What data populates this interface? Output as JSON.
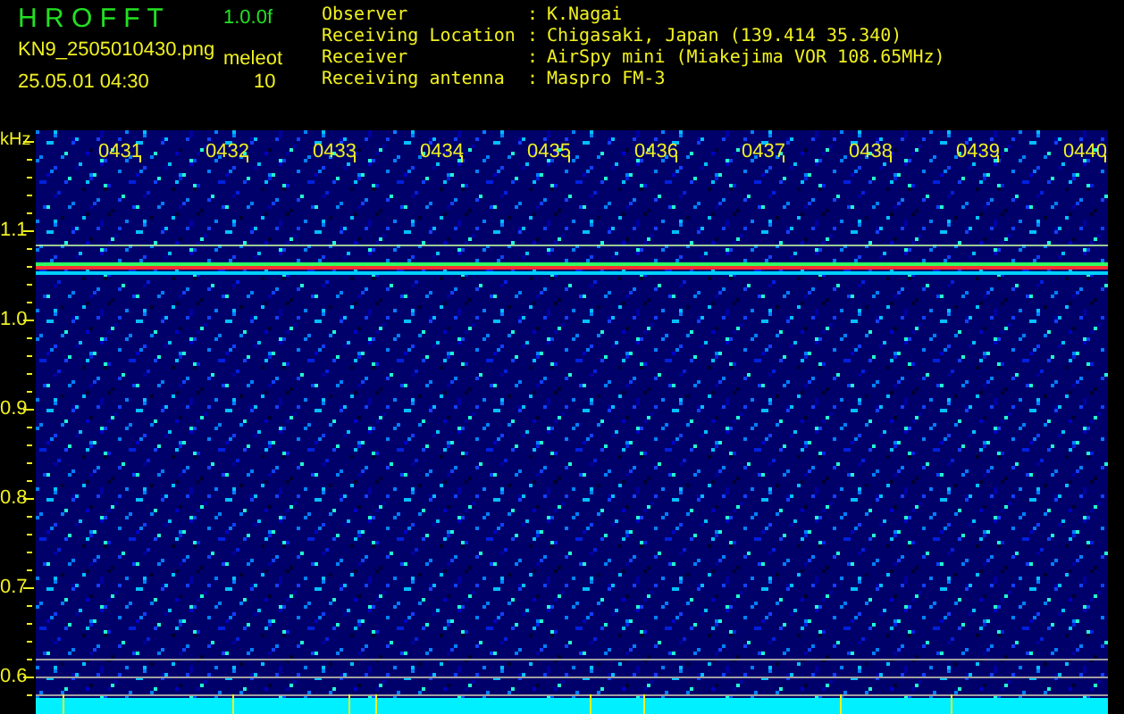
{
  "header": {
    "app_title": "H R O F F T",
    "version": "1.0.0f",
    "filename": "KN9_2505010430.png",
    "datetime": "25.05.01 04:30",
    "meteor_label": "meleot",
    "meteor_count": "10"
  },
  "info": [
    {
      "label": "Observer",
      "separator": ":",
      "value": "K.Nagai"
    },
    {
      "label": "Receiving Location",
      "separator": ":",
      "value": "Chigasaki, Japan (139.414 35.340)"
    },
    {
      "label": "Receiver",
      "separator": ":",
      "value": "AirSpy mini (Miakejima VOR 108.65MHz)"
    },
    {
      "label": "Receiving antenna",
      "separator": ":",
      "value": "Maspro FM-3"
    }
  ],
  "spectrogram": {
    "unit": "kHz",
    "time_labels": [
      "0431",
      "0432",
      "0433",
      "0434",
      "0435",
      "0436",
      "0437",
      "0438",
      "0439",
      "0440"
    ],
    "frequency_labels": [
      "1.1",
      "1.0",
      "0.9",
      "0.8",
      "0.7",
      "0.6"
    ]
  }
}
